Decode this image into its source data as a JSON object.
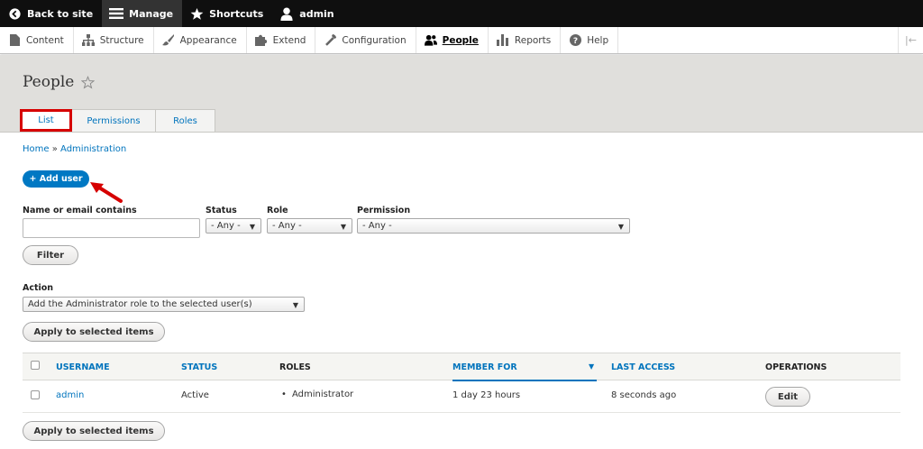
{
  "toolbar": {
    "back_to_site": "Back to site",
    "manage": "Manage",
    "shortcuts": "Shortcuts",
    "user": "admin"
  },
  "tray": {
    "items": [
      "Content",
      "Structure",
      "Appearance",
      "Extend",
      "Configuration",
      "People",
      "Reports",
      "Help"
    ],
    "toggle": "|←"
  },
  "page": {
    "title": "People"
  },
  "tabs": [
    "List",
    "Permissions",
    "Roles"
  ],
  "breadcrumb": {
    "home": "Home",
    "separator": "»",
    "admin": "Administration"
  },
  "add_user_label": "+ Add user",
  "filters": {
    "name_label": "Name or email contains",
    "name_value": "",
    "status_label": "Status",
    "status_value": "- Any -",
    "role_label": "Role",
    "role_value": "- Any -",
    "permission_label": "Permission",
    "permission_value": "- Any -",
    "filter_button": "Filter"
  },
  "action": {
    "label": "Action",
    "value": "Add the Administrator role to the selected user(s)",
    "apply_button": "Apply to selected items"
  },
  "table": {
    "headers": {
      "username": "USERNAME",
      "status": "STATUS",
      "roles": "ROLES",
      "member_for": "MEMBER FOR",
      "last_access": "LAST ACCESS",
      "operations": "OPERATIONS"
    },
    "rows": [
      {
        "username": "admin",
        "status": "Active",
        "role": "Administrator",
        "member_for": "1 day 23 hours",
        "last_access": "8 seconds ago",
        "operation": "Edit"
      }
    ]
  },
  "colors": {
    "accent": "#0074bd",
    "toolbar": "#0f0f0f",
    "highlight": "#d60000"
  }
}
